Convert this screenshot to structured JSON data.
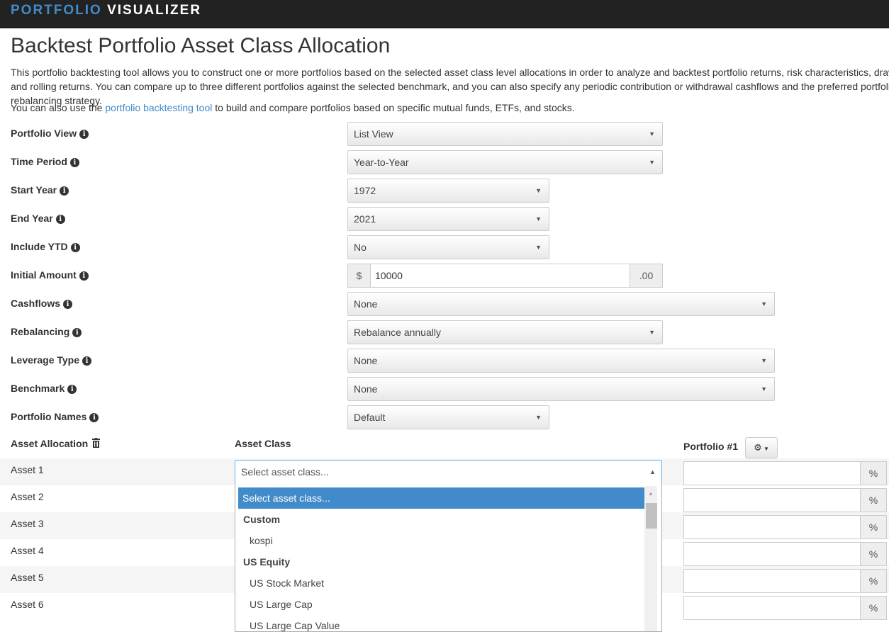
{
  "navbar": {
    "brand_part1": "PORTFOLIO",
    "brand_part2": "VISUALIZER"
  },
  "page": {
    "title": "Backtest Portfolio Asset Class Allocation",
    "intro": "This portfolio backtesting tool allows you to construct one or more portfolios based on the selected asset class level allocations in order to analyze and backtest portfolio returns, risk characteristics, drawdowns, and rolling returns. You can compare up to three different portfolios against the selected benchmark, and you can also specify any periodic contribution or withdrawal cashflows and the preferred portfolio rebalancing strategy.",
    "intro2_prefix": "You can also use the",
    "intro2_link": "portfolio backtesting tool",
    "intro2_suffix": "to build and compare portfolios based on specific mutual funds, ETFs, and stocks."
  },
  "form": {
    "portfolio_view": {
      "label": "Portfolio View",
      "value": "List View"
    },
    "time_period": {
      "label": "Time Period",
      "value": "Year-to-Year"
    },
    "start_year": {
      "label": "Start Year",
      "value": "1972"
    },
    "end_year": {
      "label": "End Year",
      "value": "2021"
    },
    "include_ytd": {
      "label": "Include YTD",
      "value": "No"
    },
    "initial_amount": {
      "label": "Initial Amount",
      "prefix": "$",
      "value": "10000",
      "suffix": ".00"
    },
    "cashflows": {
      "label": "Cashflows",
      "value": "None"
    },
    "rebalancing": {
      "label": "Rebalancing",
      "value": "Rebalance annually"
    },
    "leverage_type": {
      "label": "Leverage Type",
      "value": "None"
    },
    "benchmark": {
      "label": "Benchmark",
      "value": "None"
    },
    "portfolio_names": {
      "label": "Portfolio Names",
      "value": "Default"
    }
  },
  "allocation": {
    "header_label": "Asset Allocation",
    "asset_class_header": "Asset Class",
    "portfolio_header": "Portfolio #1",
    "percent_symbol": "%",
    "select_placeholder": "Select asset class...",
    "assets": [
      "Asset 1",
      "Asset 2",
      "Asset 3",
      "Asset 4",
      "Asset 5",
      "Asset 6"
    ],
    "dropdown_options": [
      {
        "type": "selected",
        "label": "Select asset class..."
      },
      {
        "type": "group",
        "label": "Custom"
      },
      {
        "type": "item",
        "label": "kospi"
      },
      {
        "type": "group",
        "label": "US Equity"
      },
      {
        "type": "item",
        "label": "US Stock Market"
      },
      {
        "type": "item",
        "label": "US Large Cap"
      },
      {
        "type": "item",
        "label": "US Large Cap Value"
      }
    ]
  },
  "colors": {
    "navbar": "#222222",
    "brand_accent": "#428bca",
    "link": "#428bca",
    "dropdown_highlight": "#428bca",
    "focus_border": "#66afe9"
  },
  "icons": {
    "info": "info-circle-icon",
    "trash": "trash-icon",
    "gear": "gear-icon",
    "dropdown_caret": "caret-down-icon",
    "dropdown_caret_open": "caret-up-icon"
  }
}
